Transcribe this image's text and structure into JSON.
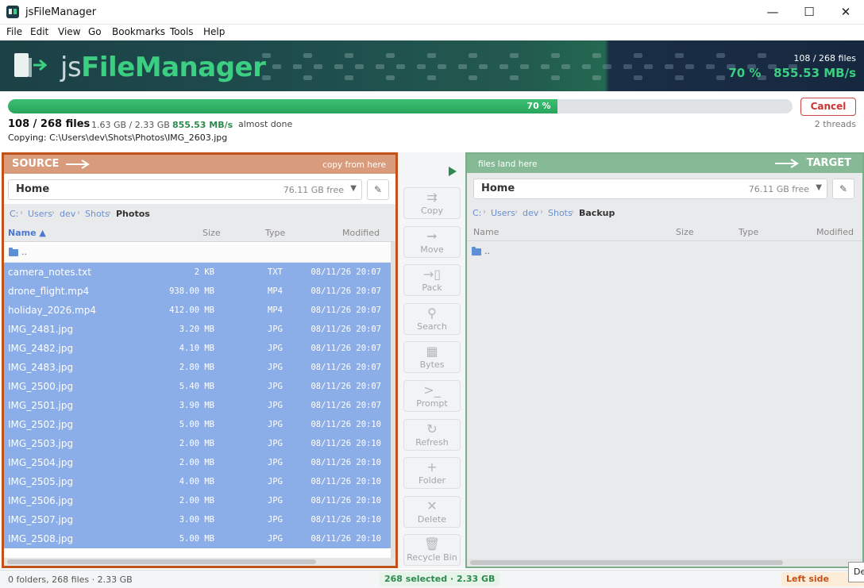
{
  "window": {
    "title": "jsFileManager",
    "minimize": "—",
    "maximize": "☐",
    "close": "✕"
  },
  "menu": [
    "File",
    "Edit",
    "View",
    "Go",
    "Bookmarks",
    "Tools",
    "Help"
  ],
  "banner": {
    "brand_js": "js",
    "brand_fm": "FileManager",
    "files": "108 / 268  files",
    "percent": "70 %",
    "rate": "855.53 MB/s"
  },
  "progress": {
    "fraction": 0.7,
    "label": "70 %",
    "cancel_label": "Cancel",
    "files": "108 / 268 files",
    "size": "1.63 GB / 2.33 GB",
    "rate": "855.53 MB/s",
    "eta": "almost done",
    "threads": "2 threads",
    "copying_label": "Copying:",
    "copying_path": "C:\\Users\\dev\\Shots\\Photos\\IMG_2603.jpg"
  },
  "source": {
    "label": "SOURCE",
    "hint": "copy from here",
    "location": "Home",
    "free": "76.11 GB free",
    "breadcrumb": [
      "C:",
      "Users",
      "dev",
      "Shots",
      "Photos"
    ],
    "columns": {
      "name": "Name ▲",
      "size": "Size",
      "type": "Type",
      "modified": "Modified"
    },
    "up": "..",
    "files": [
      {
        "name": "camera_notes.txt",
        "size": "2 KB",
        "type": "TXT",
        "modified": "08/11/26 20:07"
      },
      {
        "name": "drone_flight.mp4",
        "size": "938.00 MB",
        "type": "MP4",
        "modified": "08/11/26 20:07"
      },
      {
        "name": "holiday_2026.mp4",
        "size": "412.00 MB",
        "type": "MP4",
        "modified": "08/11/26 20:07"
      },
      {
        "name": "IMG_2481.jpg",
        "size": "3.20 MB",
        "type": "JPG",
        "modified": "08/11/26 20:07"
      },
      {
        "name": "IMG_2482.jpg",
        "size": "4.10 MB",
        "type": "JPG",
        "modified": "08/11/26 20:07"
      },
      {
        "name": "IMG_2483.jpg",
        "size": "2.80 MB",
        "type": "JPG",
        "modified": "08/11/26 20:07"
      },
      {
        "name": "IMG_2500.jpg",
        "size": "5.40 MB",
        "type": "JPG",
        "modified": "08/11/26 20:07"
      },
      {
        "name": "IMG_2501.jpg",
        "size": "3.90 MB",
        "type": "JPG",
        "modified": "08/11/26 20:07"
      },
      {
        "name": "IMG_2502.jpg",
        "size": "5.00 MB",
        "type": "JPG",
        "modified": "08/11/26 20:10"
      },
      {
        "name": "IMG_2503.jpg",
        "size": "2.00 MB",
        "type": "JPG",
        "modified": "08/11/26 20:10"
      },
      {
        "name": "IMG_2504.jpg",
        "size": "2.00 MB",
        "type": "JPG",
        "modified": "08/11/26 20:10"
      },
      {
        "name": "IMG_2505.jpg",
        "size": "4.00 MB",
        "type": "JPG",
        "modified": "08/11/26 20:10"
      },
      {
        "name": "IMG_2506.jpg",
        "size": "2.00 MB",
        "type": "JPG",
        "modified": "08/11/26 20:10"
      },
      {
        "name": "IMG_2507.jpg",
        "size": "3.00 MB",
        "type": "JPG",
        "modified": "08/11/26 20:10"
      },
      {
        "name": "IMG_2508.jpg",
        "size": "5.00 MB",
        "type": "JPG",
        "modified": "08/11/26 20:10"
      }
    ]
  },
  "target": {
    "label": "TARGET",
    "hint": "files land here",
    "location": "Home",
    "free": "76.11 GB free",
    "breadcrumb": [
      "C:",
      "Users",
      "dev",
      "Shots",
      "Backup"
    ],
    "columns": {
      "name": "Name",
      "size": "Size",
      "type": "Type",
      "modified": "Modified"
    },
    "up": ".."
  },
  "tools": [
    {
      "label": "Copy",
      "icon": "copy-arrows-icon",
      "glyph": "⇉"
    },
    {
      "label": "Move",
      "icon": "move-arrow-icon",
      "glyph": "➞"
    },
    {
      "label": "Pack",
      "icon": "pack-icon",
      "glyph": "→▯"
    },
    {
      "label": "Search",
      "icon": "search-icon",
      "glyph": "⚲"
    },
    {
      "label": "Bytes",
      "icon": "bytes-grid-icon",
      "glyph": "▦"
    },
    {
      "label": "Prompt",
      "icon": "terminal-icon",
      "glyph": ">_"
    },
    {
      "label": "Refresh",
      "icon": "refresh-icon",
      "glyph": "↻"
    },
    {
      "label": "Folder",
      "icon": "new-folder-plus-icon",
      "glyph": "+"
    },
    {
      "label": "Delete",
      "icon": "delete-x-icon",
      "glyph": "✕"
    },
    {
      "label": "Recycle Bin",
      "icon": "recycle-bin-icon",
      "glyph": "🗑"
    }
  ],
  "status": {
    "left": "0 folders, 268 files  ·  2.33 GB",
    "selected": "268 selected  ·  2.33 GB",
    "side": "Left side active",
    "tooltip": "De"
  },
  "colors": {
    "source_accent": "#c0521a",
    "target_accent": "#7aae8a",
    "progress": "#2fb163",
    "selection": "#8caee8"
  }
}
